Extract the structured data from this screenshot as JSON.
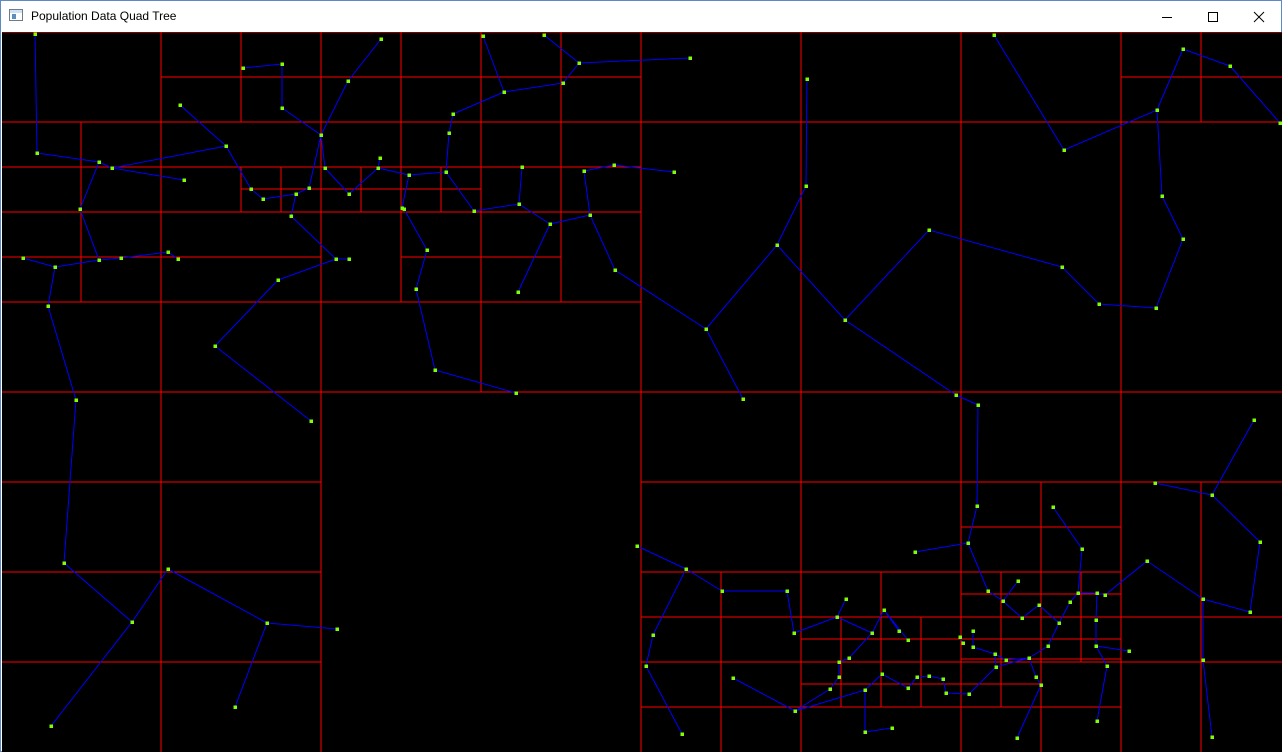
{
  "window": {
    "title": "Population Data Quad Tree",
    "app_icon": "application-window-icon",
    "controls": [
      {
        "name": "minimize-button",
        "icon": "minimize-icon"
      },
      {
        "name": "maximize-button",
        "icon": "maximize-icon"
      },
      {
        "name": "close-button",
        "icon": "close-icon"
      }
    ]
  },
  "colors": {
    "background": "#000000",
    "quad_lines": "#ff0000",
    "edges": "#0000ff",
    "points": "#7fff00"
  }
}
